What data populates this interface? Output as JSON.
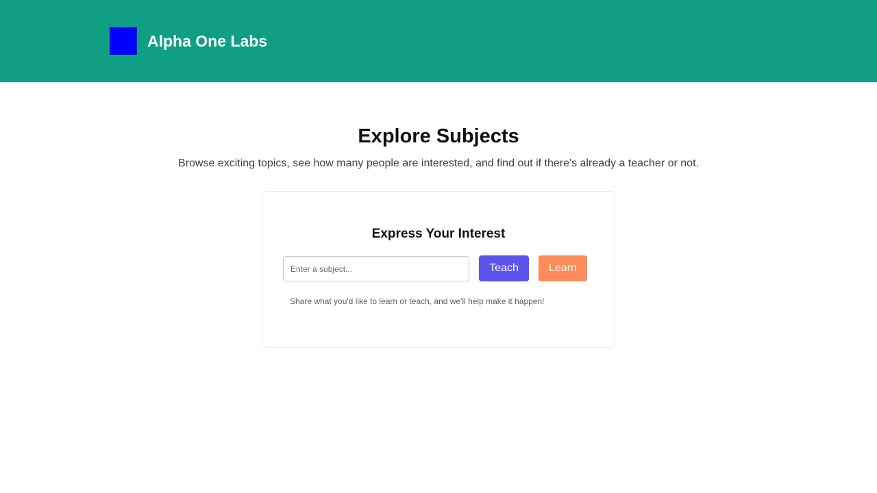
{
  "colors": {
    "header_bg": "#109e84",
    "logo": "#0000ff",
    "teach_button": "#5c54ec",
    "learn_button": "#fb8b58"
  },
  "header": {
    "logo_icon": "square-logo",
    "brand_name": "Alpha One Labs"
  },
  "main": {
    "title": "Explore Subjects",
    "subtitle": "Browse exciting topics, see how many people are interested, and find out if there's already a teacher or not."
  },
  "interest_card": {
    "title": "Express Your Interest",
    "input_value": "",
    "input_placeholder": "Enter a subject...",
    "teach_label": "Teach",
    "learn_label": "Learn",
    "hint": "Share what you'd like to learn or teach, and we'll help make it happen!"
  }
}
